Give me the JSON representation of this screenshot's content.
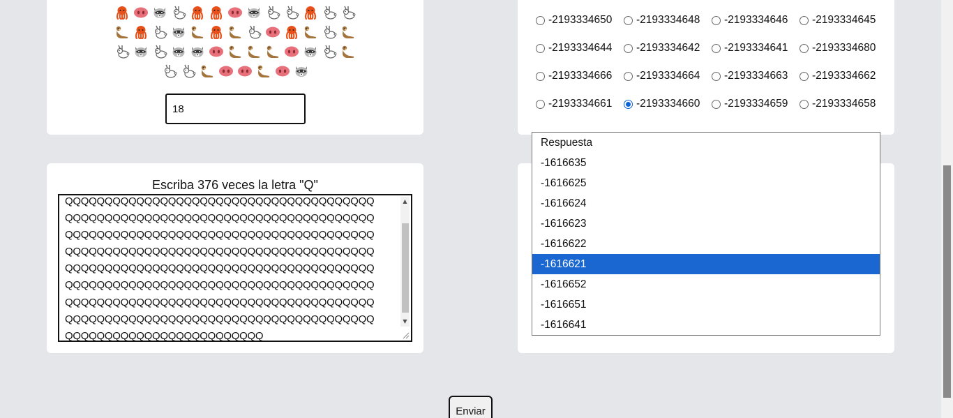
{
  "emoji_card": {
    "rows": [
      [
        "octopus",
        "pig-nose",
        "raccoon",
        "rabbit",
        "octopus",
        "octopus",
        "pig-nose",
        "raccoon",
        "rabbit",
        "rabbit",
        "octopus",
        "rabbit",
        "rabbit"
      ],
      [
        "otter",
        "octopus",
        "rabbit",
        "raccoon",
        "otter",
        "octopus",
        "otter",
        "rabbit",
        "pig-nose",
        "octopus",
        "otter",
        "rabbit",
        "otter"
      ],
      [
        "rabbit",
        "raccoon",
        "rabbit",
        "raccoon",
        "raccoon",
        "pig-nose",
        "otter",
        "otter",
        "otter",
        "pig-nose",
        "raccoon",
        "rabbit",
        "otter"
      ],
      [
        "rabbit",
        "rabbit",
        "otter",
        "pig-nose",
        "pig-nose",
        "otter",
        "pig-nose",
        "raccoon"
      ]
    ],
    "count_value": "18"
  },
  "radio_card": {
    "options": [
      {
        "label": "-2193334650",
        "checked": false
      },
      {
        "label": "-2193334648",
        "checked": false
      },
      {
        "label": "-2193334646",
        "checked": false
      },
      {
        "label": "-2193334645",
        "checked": false
      },
      {
        "label": "-2193334644",
        "checked": false
      },
      {
        "label": "-2193334642",
        "checked": false
      },
      {
        "label": "-2193334641",
        "checked": false
      },
      {
        "label": "-2193334680",
        "checked": false
      },
      {
        "label": "-2193334666",
        "checked": false
      },
      {
        "label": "-2193334664",
        "checked": false
      },
      {
        "label": "-2193334663",
        "checked": false
      },
      {
        "label": "-2193334662",
        "checked": false
      },
      {
        "label": "-2193334661",
        "checked": false
      },
      {
        "label": "-2193334660",
        "checked": true
      },
      {
        "label": "-2193334659",
        "checked": false
      },
      {
        "label": "-2193334658",
        "checked": false
      }
    ]
  },
  "text_card": {
    "prompt": "Escriba 376 veces la letra \"Q\"",
    "lines": [
      "QQQQQQQQQQQQQQQQQQQQQQQQQQQQQQQQQQQQQQQ",
      "QQQQQQQQQQQQQQQQQQQQQQQQQQQQQQQQQQQQQQQ",
      "QQQQQQQQQQQQQQQQQQQQQQQQQQQQQQQQQQQQQQQ",
      "QQQQQQQQQQQQQQQQQQQQQQQQQQQQQQQQQQQQQQQ",
      "QQQQQQQQQQQQQQQQQQQQQQQQQQQQQQQQQQQQQQQ",
      "QQQQQQQQQQQQQQQQQQQQQQQQQQQQQQQQQQQQQQQ",
      "QQQQQQQQQQQQQQQQQQQQQQQQQQQQQQQQQQQQQQQ",
      "QQQQQQQQQQQQQQQQQQQQQQQQQQQQQQQQQQQQQQQ",
      "QQQQQQQQQQQQQQQQQQQQQQQQQ"
    ]
  },
  "select_card": {
    "options": [
      {
        "label": "Respuesta",
        "selected": false
      },
      {
        "label": "-1616635",
        "selected": false
      },
      {
        "label": "-1616625",
        "selected": false
      },
      {
        "label": "-1616624",
        "selected": false
      },
      {
        "label": "-1616623",
        "selected": false
      },
      {
        "label": "-1616622",
        "selected": false
      },
      {
        "label": "-1616621",
        "selected": true
      },
      {
        "label": "-1616652",
        "selected": false
      },
      {
        "label": "-1616651",
        "selected": false
      },
      {
        "label": "-1616641",
        "selected": false
      }
    ]
  },
  "submit": {
    "label": "Enviar"
  },
  "colors": {
    "page_bg": "#e5e6e9",
    "accent": "#1a67d2"
  }
}
